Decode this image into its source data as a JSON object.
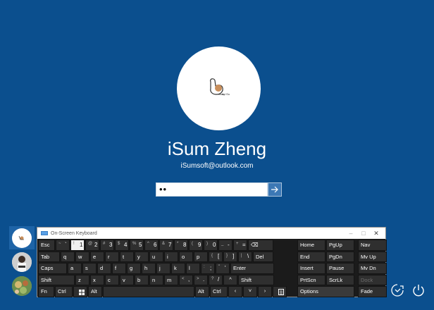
{
  "user": {
    "name": "iSum Zheng",
    "email": "iSumsoft@outlook.com",
    "password_value": "••"
  },
  "switch_users": [
    {
      "name": "user-1",
      "selected": true
    },
    {
      "name": "user-2",
      "selected": false
    },
    {
      "name": "user-3",
      "selected": false
    }
  ],
  "osk": {
    "title": "On-Screen Keyboard",
    "controls": [
      "–",
      "□",
      "✕"
    ],
    "rows": [
      [
        {
          "label": "Esc",
          "w": 25
        },
        {
          "sub": "~",
          "main": "`",
          "w": 21
        },
        {
          "sub": "!",
          "main": "1",
          "w": 21,
          "pressed": true
        },
        {
          "sub": "@",
          "main": "2",
          "w": 21
        },
        {
          "sub": "#",
          "main": "3",
          "w": 21
        },
        {
          "sub": "$",
          "main": "4",
          "w": 21
        },
        {
          "sub": "%",
          "main": "5",
          "w": 21
        },
        {
          "sub": "^",
          "main": "6",
          "w": 21
        },
        {
          "sub": "&",
          "main": "7",
          "w": 21
        },
        {
          "sub": "*",
          "main": "8",
          "w": 21
        },
        {
          "sub": "(",
          "main": "9",
          "w": 21
        },
        {
          "sub": ")",
          "main": "0",
          "w": 21
        },
        {
          "sub": "_",
          "main": "-",
          "w": 21
        },
        {
          "sub": "+",
          "main": "=",
          "w": 21
        },
        {
          "label": "⌫",
          "w": 37
        }
      ],
      [
        {
          "label": "Tab",
          "w": 32
        },
        {
          "label": "q",
          "w": 21
        },
        {
          "label": "w",
          "w": 21
        },
        {
          "label": "e",
          "w": 21
        },
        {
          "label": "r",
          "w": 21
        },
        {
          "label": "t",
          "w": 21
        },
        {
          "label": "y",
          "w": 21
        },
        {
          "label": "u",
          "w": 21
        },
        {
          "label": "i",
          "w": 21
        },
        {
          "label": "o",
          "w": 21
        },
        {
          "label": "p",
          "w": 21
        },
        {
          "sub": "{",
          "main": "[",
          "w": 21
        },
        {
          "sub": "}",
          "main": "]",
          "w": 21
        },
        {
          "sub": "|",
          "main": "\\",
          "w": 21
        },
        {
          "label": "Del",
          "w": 30
        }
      ],
      [
        {
          "label": "Caps",
          "w": 42
        },
        {
          "label": "a",
          "w": 21
        },
        {
          "label": "s",
          "w": 21
        },
        {
          "label": "d",
          "w": 21
        },
        {
          "label": "f",
          "w": 21
        },
        {
          "label": "g",
          "w": 21
        },
        {
          "label": "h",
          "w": 21
        },
        {
          "label": "j",
          "w": 21
        },
        {
          "label": "k",
          "w": 21
        },
        {
          "label": "l",
          "w": 21
        },
        {
          "sub": ":",
          "main": ";",
          "w": 21
        },
        {
          "sub": "\"",
          "main": "'",
          "w": 21
        },
        {
          "label": "Enter",
          "w": 63
        }
      ],
      [
        {
          "label": "Shift",
          "w": 53
        },
        {
          "label": "z",
          "w": 21
        },
        {
          "label": "x",
          "w": 21
        },
        {
          "label": "c",
          "w": 21
        },
        {
          "label": "v",
          "w": 21
        },
        {
          "label": "b",
          "w": 21
        },
        {
          "label": "n",
          "w": 21
        },
        {
          "label": "m",
          "w": 21
        },
        {
          "sub": "<",
          "main": ",",
          "w": 21
        },
        {
          "sub": ">",
          "main": ".",
          "w": 21
        },
        {
          "sub": "?",
          "main": "/",
          "w": 21
        },
        {
          "label": "^",
          "w": 21,
          "center": true
        },
        {
          "label": "Shift",
          "w": 52
        }
      ],
      [
        {
          "label": "Fn",
          "w": 24
        },
        {
          "label": "Ctrl",
          "w": 26
        },
        {
          "label": "win-icon",
          "w": 21,
          "icon": true
        },
        {
          "label": "Alt",
          "w": 21
        },
        {
          "label": "",
          "w": 131
        },
        {
          "label": "Alt",
          "w": 21
        },
        {
          "label": "Ctrl",
          "w": 26
        },
        {
          "label": "‹",
          "w": 21,
          "center": true
        },
        {
          "label": "˅",
          "w": 21,
          "center": true
        },
        {
          "label": "›",
          "w": 21,
          "center": true
        },
        {
          "label": "menu-icon",
          "w": 21,
          "icon": true
        }
      ]
    ],
    "nav_keys": [
      [
        "Home",
        "PgUp",
        "Nav"
      ],
      [
        "End",
        "PgDn",
        "Mv Up"
      ],
      [
        "Insert",
        "Pause",
        "Mv Dn"
      ],
      [
        "PrtScn",
        "ScrLk",
        "Dock"
      ],
      [
        "Options",
        "",
        "Fade"
      ]
    ]
  },
  "system": {
    "ease_of_access": "ease-of-access-icon",
    "power": "power-icon"
  }
}
